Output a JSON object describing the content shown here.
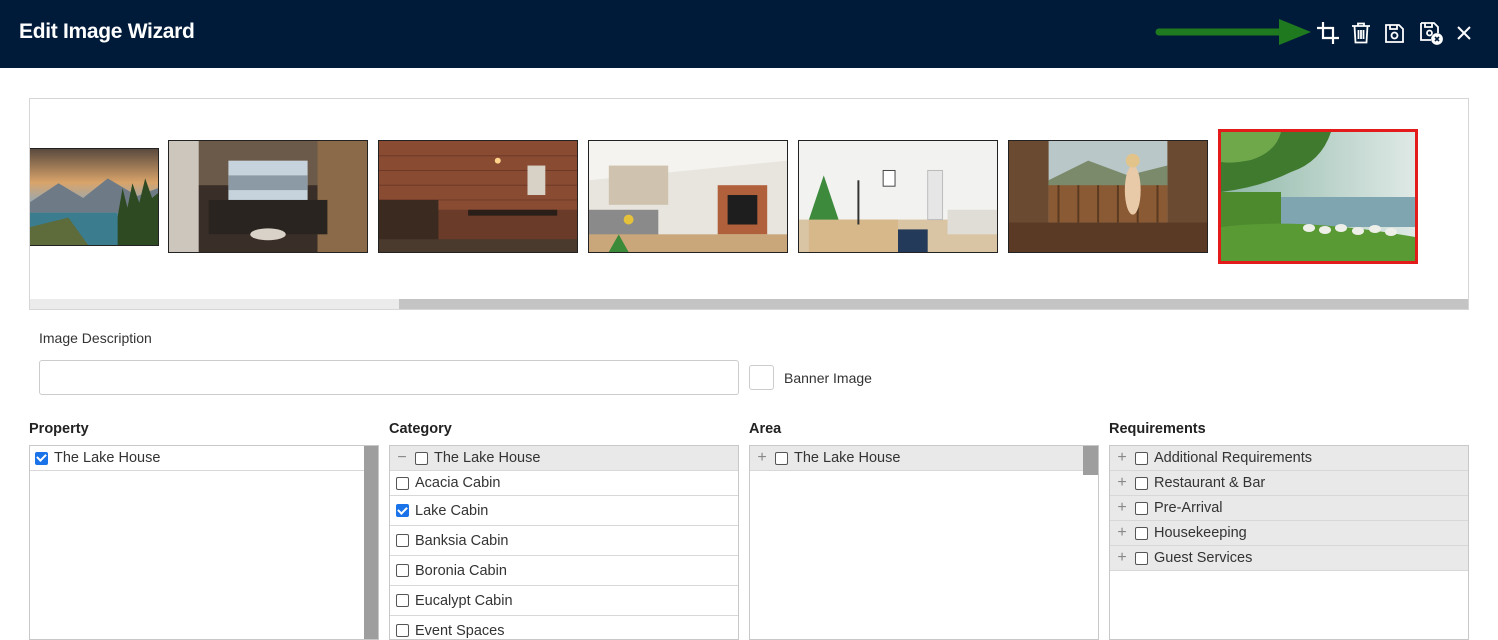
{
  "header": {
    "title": "Edit Image Wizard"
  },
  "toolbar": {
    "icons": [
      "crop-icon",
      "trash-icon",
      "save-icon",
      "save-close-icon",
      "close-icon"
    ]
  },
  "gallery": {
    "image_count": 7,
    "selected_index": 6
  },
  "description": {
    "label": "Image Description",
    "value": "",
    "placeholder": "",
    "banner_label": "Banner Image",
    "banner_checked": false
  },
  "property": {
    "title": "Property",
    "items": [
      {
        "label": "The Lake House",
        "checked": true
      }
    ]
  },
  "category": {
    "title": "Category",
    "group": {
      "label": "The Lake House",
      "checked": false,
      "expanded": true
    },
    "items": [
      {
        "label": "Acacia Cabin",
        "checked": false
      },
      {
        "label": "Lake Cabin",
        "checked": true
      },
      {
        "label": "Banksia Cabin",
        "checked": false
      },
      {
        "label": "Boronia Cabin",
        "checked": false
      },
      {
        "label": "Eucalypt Cabin",
        "checked": false
      },
      {
        "label": "Event Spaces",
        "checked": false
      }
    ]
  },
  "area": {
    "title": "Area",
    "items": [
      {
        "label": "The Lake House",
        "checked": false,
        "expanded": false
      }
    ]
  },
  "requirements": {
    "title": "Requirements",
    "items": [
      {
        "label": "Additional Requirements",
        "checked": false,
        "expanded": false
      },
      {
        "label": "Restaurant & Bar",
        "checked": false,
        "expanded": false
      },
      {
        "label": "Pre-Arrival",
        "checked": false,
        "expanded": false
      },
      {
        "label": "Housekeeping",
        "checked": false,
        "expanded": false
      },
      {
        "label": "Guest Services",
        "checked": false,
        "expanded": false
      }
    ]
  },
  "colors": {
    "header_bg": "#001b3a",
    "accent_green": "#1f7a1f",
    "selected_border": "#e31b1b",
    "checkbox_blue": "#1a73e8"
  }
}
